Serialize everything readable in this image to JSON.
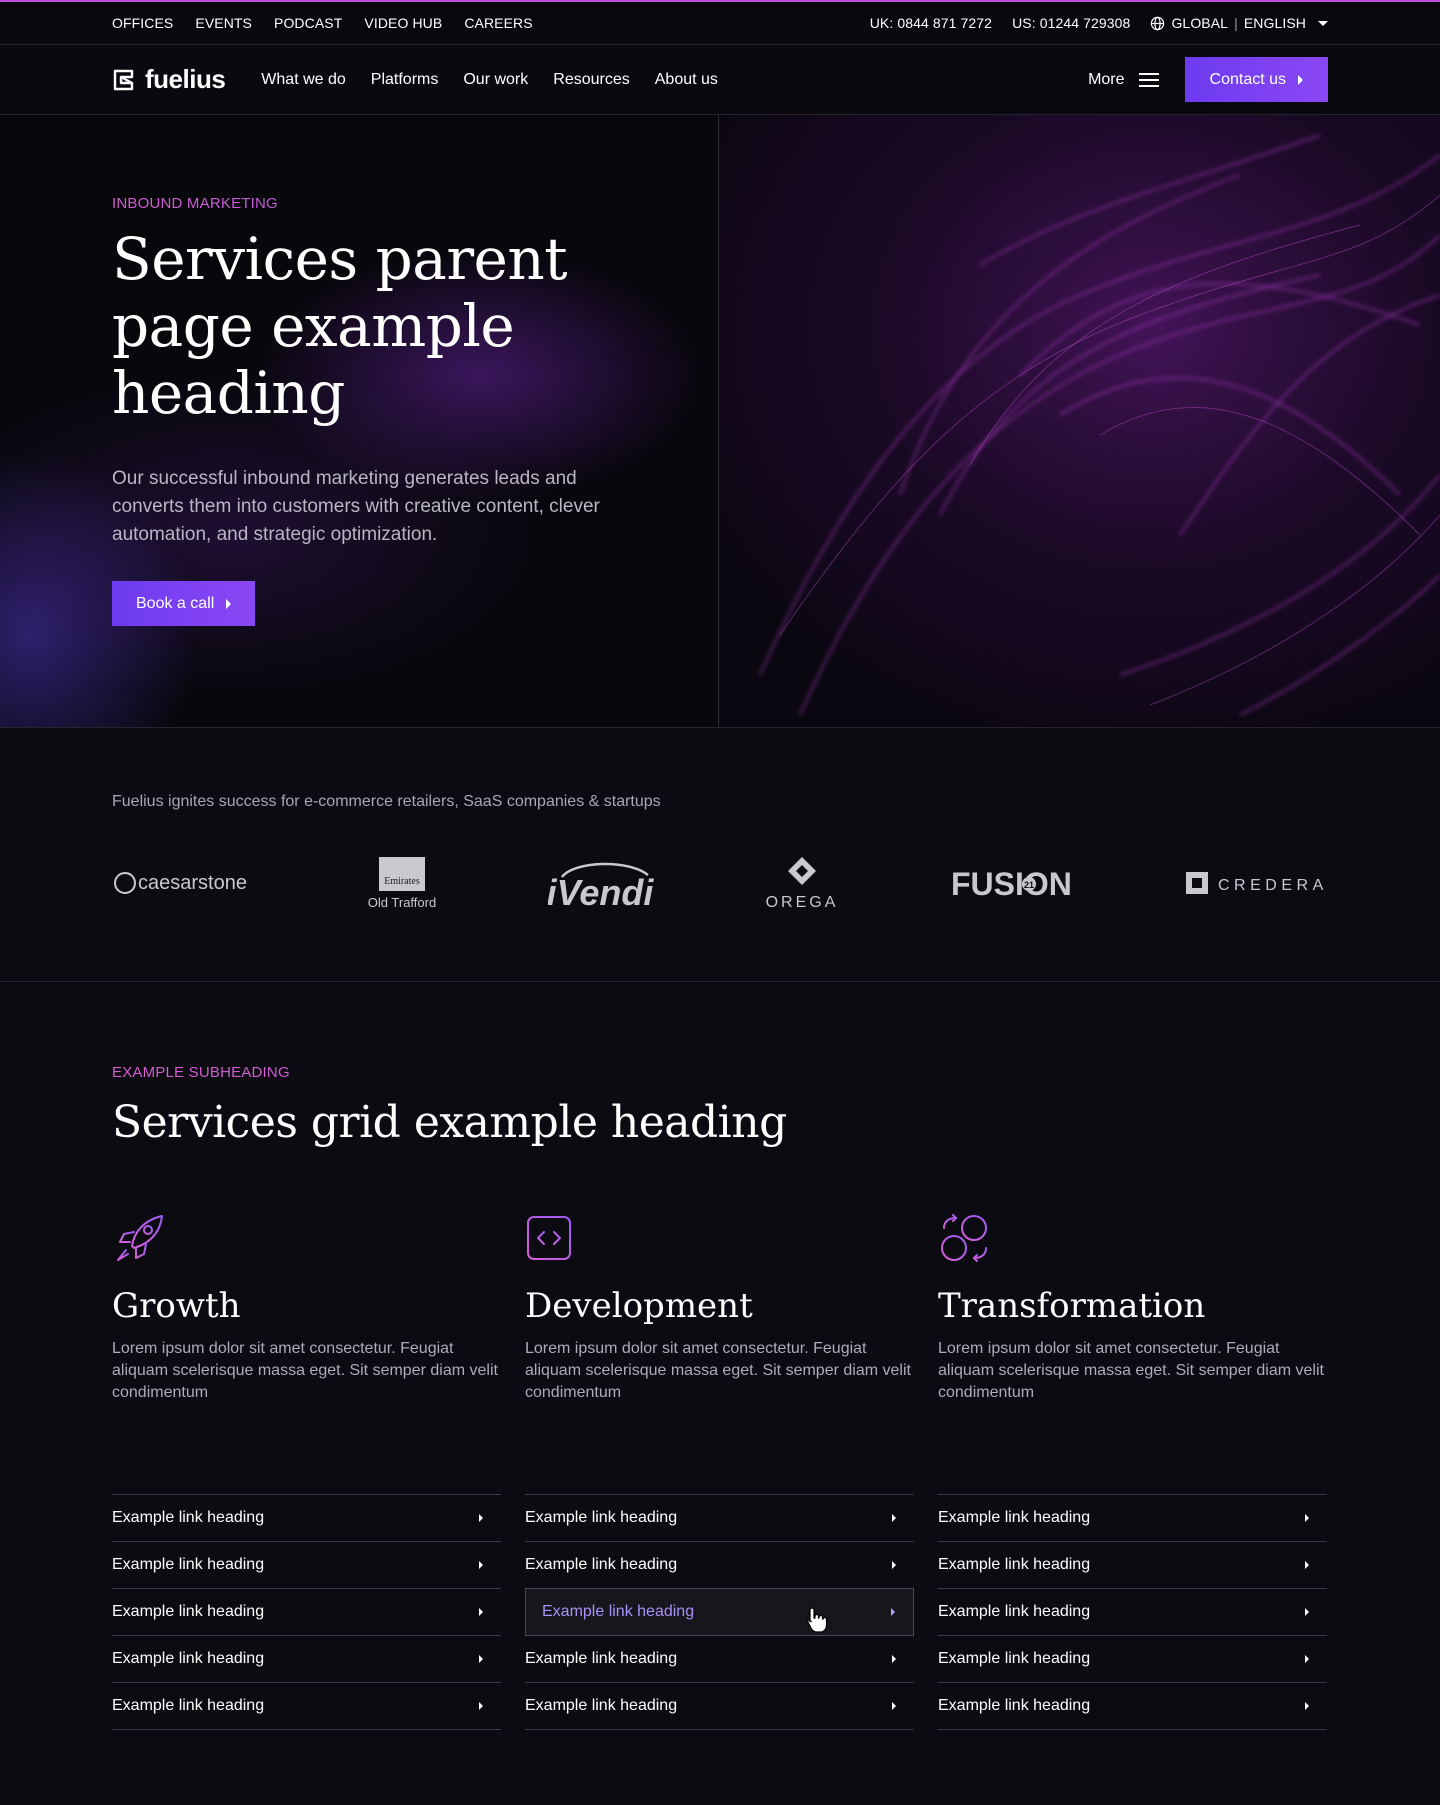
{
  "topbar": {
    "links": [
      "OFFICES",
      "EVENTS",
      "PODCAST",
      "VIDEO HUB",
      "CAREERS"
    ],
    "phone_uk": "UK: 0844 871 7272",
    "phone_us": "US: 01244 729308",
    "region": "GLOBAL",
    "language": "ENGLISH",
    "icons": {
      "globe": "globe-icon",
      "caret": "chevron-down-icon"
    }
  },
  "nav": {
    "brand": "fuelius",
    "links": [
      "What we do",
      "Platforms",
      "Our work",
      "Resources",
      "About us"
    ],
    "more_label": "More",
    "contact_label": "Contact us"
  },
  "hero": {
    "eyebrow": "INBOUND MARKETING",
    "heading": "Services parent page example heading",
    "lead": "Our successful inbound marketing generates leads and converts them into customers with creative content, clever automation, and strategic optimization.",
    "cta_label": "Book a call"
  },
  "clients": {
    "intro": "Fuelius ignites success for e-commerce retailers, SaaS companies & startups",
    "logos": {
      "caesarstone": "caesarstone",
      "emirates_top": "Emirates",
      "emirates_bottom": "Old Trafford",
      "ivendi": "iVendi",
      "orega": "OREGA",
      "fusion": "FUSION",
      "fusion_badge": "21",
      "credera": "CREDERA"
    }
  },
  "services": {
    "eyebrow": "EXAMPLE SUBHEADING",
    "heading": "Services grid example heading",
    "columns": [
      {
        "icon": "rocket-icon",
        "title": "Growth",
        "desc": "Lorem ipsum dolor sit amet consectetur. Feugiat aliquam scelerisque massa eget. Sit semper diam velit condimentum",
        "links": [
          "Example link heading",
          "Example link heading",
          "Example link heading",
          "Example link heading",
          "Example link heading"
        ]
      },
      {
        "icon": "code-icon",
        "title": "Development",
        "desc": "Lorem ipsum dolor sit amet consectetur. Feugiat aliquam scelerisque massa eget. Sit semper diam velit condimentum",
        "links": [
          "Example link heading",
          "Example link heading",
          "Example link heading",
          "Example link heading",
          "Example link heading"
        ]
      },
      {
        "icon": "transform-icon",
        "title": "Transformation",
        "desc": "Lorem ipsum dolor sit amet consectetur. Feugiat aliquam scelerisque massa eget. Sit semper diam velit condimentum",
        "links": [
          "Example link heading",
          "Example link heading",
          "Example link heading",
          "Example link heading",
          "Example link heading"
        ]
      }
    ]
  },
  "colors": {
    "accent": "#7c3aed",
    "accent_pink": "#d75ed0",
    "link_hover": "#a891f6",
    "background": "#0c0b11"
  }
}
